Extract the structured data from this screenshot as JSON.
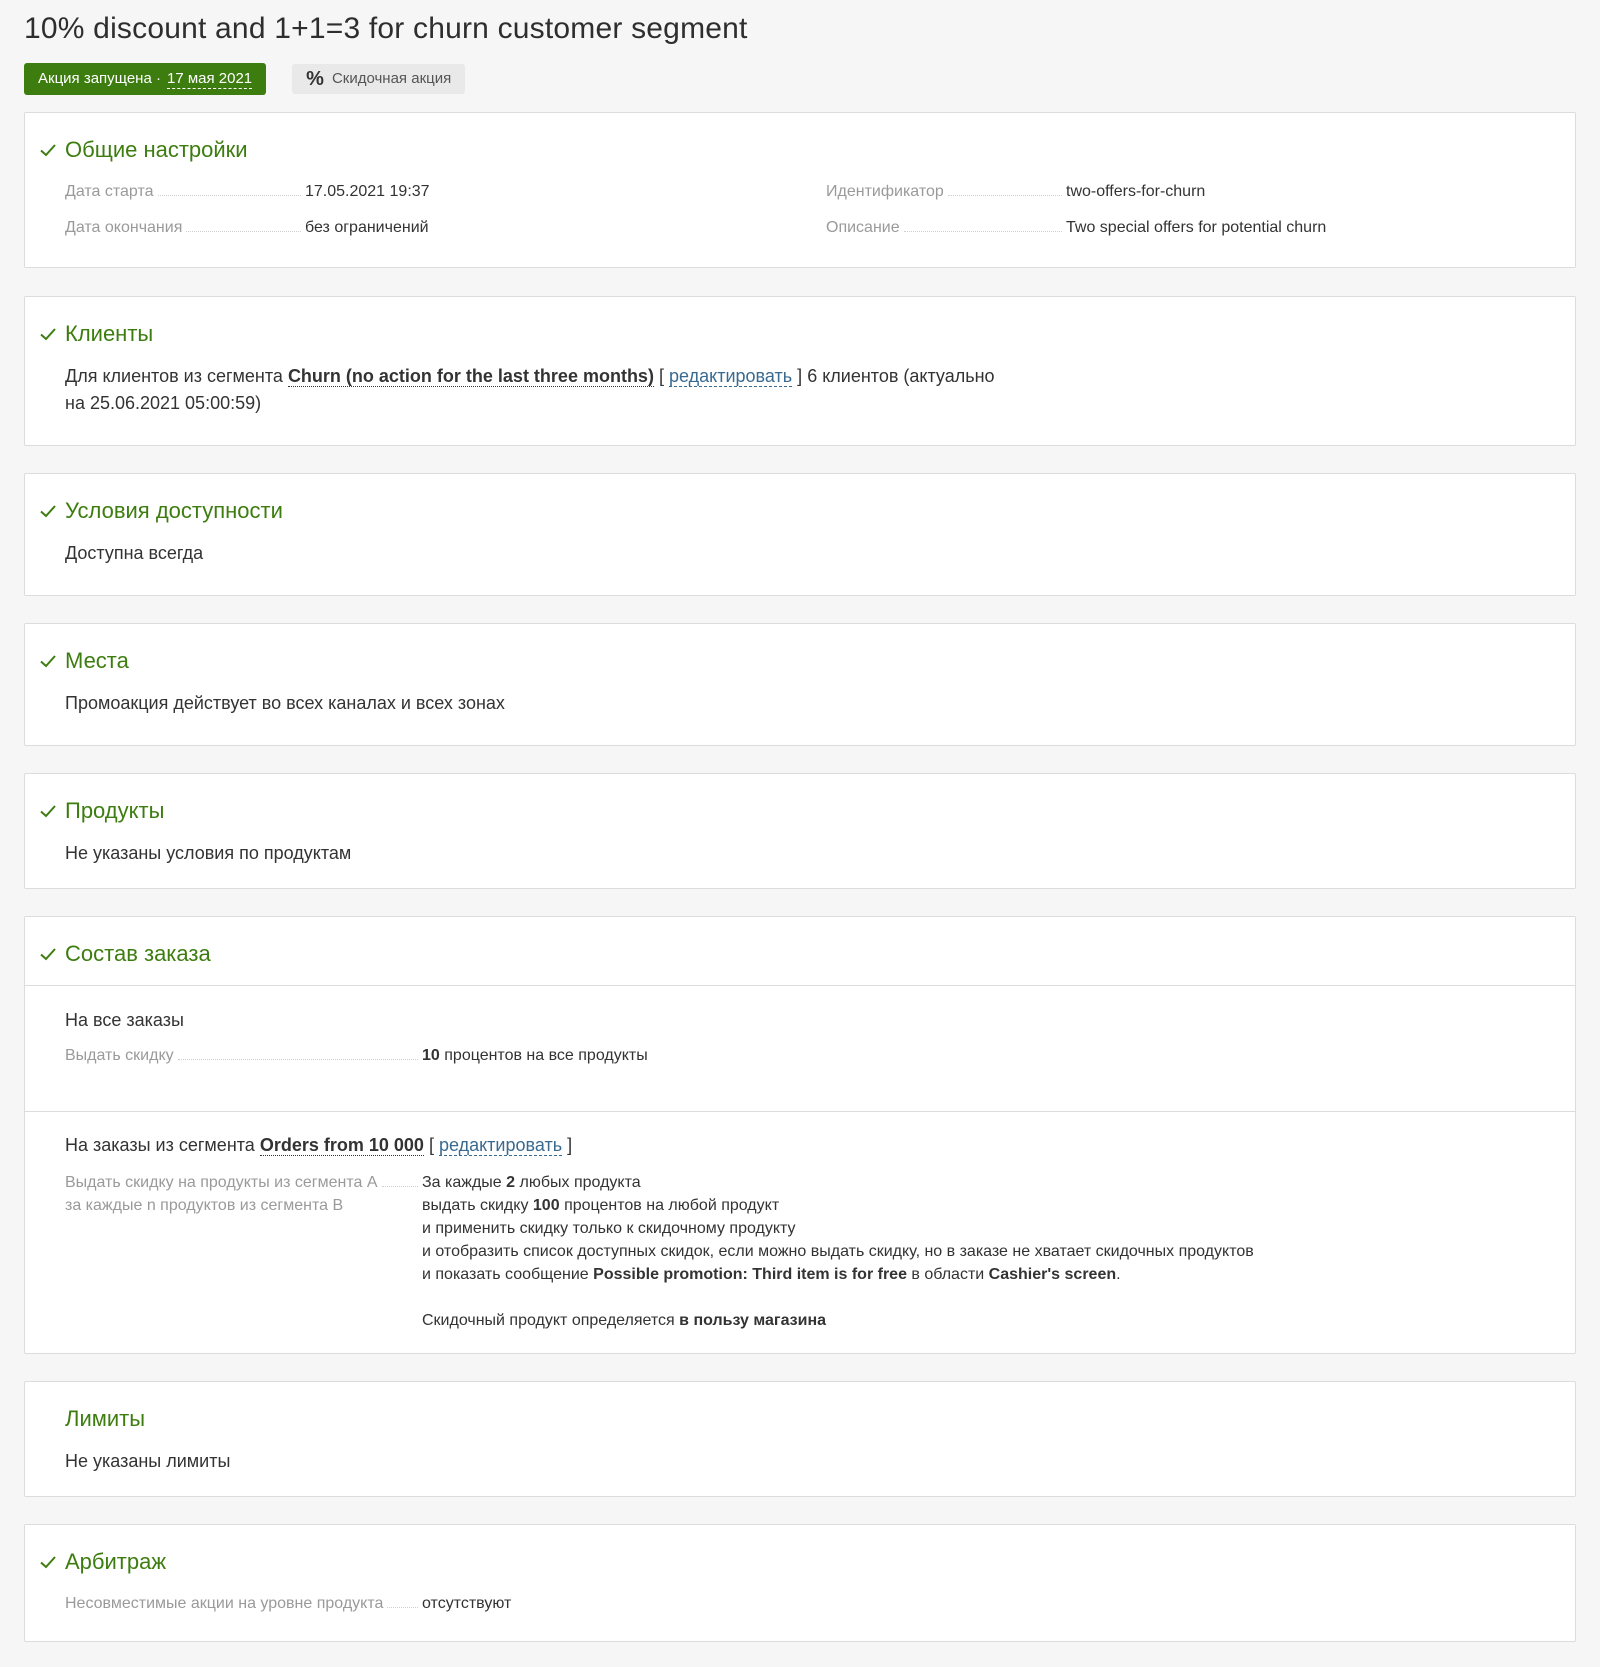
{
  "header": {
    "title": "10% discount and 1+1=3 for churn customer segment",
    "status_label": "Акция запущена ·",
    "status_date": "17 мая 2021",
    "type_icon": "%",
    "type_label": "Скидочная акция"
  },
  "general": {
    "title": "Общие настройки",
    "start_label": "Дата старта",
    "start_value": "17.05.2021 19:37",
    "end_label": "Дата окончания",
    "end_value": "без ограничений",
    "id_label": "Идентификатор",
    "id_value": "two-offers-for-churn",
    "desc_label": "Описание",
    "desc_value": "Two special offers for potential churn"
  },
  "clients": {
    "title": "Клиенты",
    "prefix": "Для клиентов из сегмента",
    "segment": "Churn (no action for the last three months)",
    "bracket_open": "[",
    "edit": "редактировать",
    "bracket_close": "]",
    "count_line1": "6 клиентов (актуально",
    "count_line2": "на 25.06.2021 05:00:59)"
  },
  "availability": {
    "title": "Условия доступности",
    "text": "Доступна всегда"
  },
  "places": {
    "title": "Места",
    "text": "Промоакция действует во всех каналах и всех зонах"
  },
  "products": {
    "title": "Продукты",
    "text": "Не указаны условия по продуктам"
  },
  "order": {
    "title": "Состав заказа",
    "all_orders": "На все заказы",
    "discount_label": "Выдать скидку",
    "discount_value_num": "10",
    "discount_value_text": "процентов на все продукты",
    "segment_prefix": "На заказы из сегмента",
    "segment_name": "Orders from 10 000",
    "bracket_open": "[",
    "edit": "редактировать",
    "bracket_close": "]",
    "rule_label_1": "Выдать скидку на продукты из сегмента A",
    "rule_label_2": "за каждые n продуктов из сегмента B",
    "rule_1_a": "За каждые",
    "rule_1_num": "2",
    "rule_1_b": "любых продукта",
    "rule_2_a": "выдать скидку",
    "rule_2_num": "100",
    "rule_2_b": "процентов на любой продукт",
    "rule_3": "и применить скидку только к скидочному продукту",
    "rule_4": "и отобразить список доступных скидок, если можно выдать скидку, но в заказе не хватает скидочных продуктов",
    "rule_5_a": "и показать сообщение",
    "rule_5_msg": "Possible promotion: Third item is for free",
    "rule_5_b": "в области",
    "rule_5_area": "Cashier's screen",
    "rule_5_end": ".",
    "rule_6_a": "Скидочный продукт определяется",
    "rule_6_b": "в пользу магазина"
  },
  "limits": {
    "title": "Лимиты",
    "text": "Не указаны лимиты"
  },
  "arbitrage": {
    "title": "Арбитраж",
    "label": "Несовместимые акции на уровне продукта",
    "value": "отсутствуют"
  },
  "colors": {
    "accent": "#3d7d0f",
    "link": "#3a6a8f",
    "muted": "#9a9a9a",
    "border": "#dcdcdc"
  },
  "icons": {
    "check": "check-icon",
    "percent": "percent-icon"
  }
}
